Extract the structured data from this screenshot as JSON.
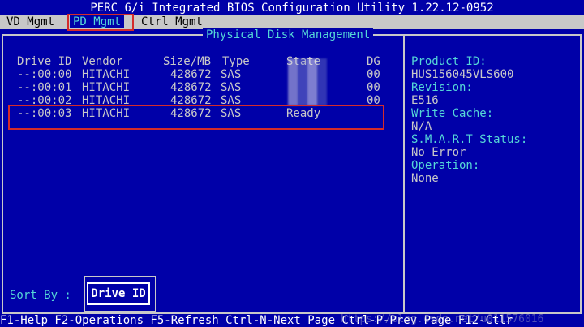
{
  "app": {
    "title": "PERC 6/i Integrated BIOS Configuration Utility 1.22.12-0952"
  },
  "menu": [
    {
      "label": "VD Mgmt"
    },
    {
      "label": "PD Mgmt"
    },
    {
      "label": "Ctrl Mgmt"
    }
  ],
  "panel": {
    "title": "Physical Disk Management"
  },
  "table": {
    "headers": {
      "drive_id": "Drive ID",
      "vendor": "Vendor",
      "size": "Size/MB",
      "type": "Type",
      "state": "State",
      "dg": "DG"
    },
    "rows": [
      {
        "drive_id": "--:00:00",
        "vendor": "HITACHI",
        "size": "428672",
        "type": "SAS",
        "state": "",
        "dg": "00"
      },
      {
        "drive_id": "--:00:01",
        "vendor": "HITACHI",
        "size": "428672",
        "type": "SAS",
        "state": "",
        "dg": "00"
      },
      {
        "drive_id": "--:00:02",
        "vendor": "HITACHI",
        "size": "428672",
        "type": "SAS",
        "state": "",
        "dg": "00"
      },
      {
        "drive_id": "--:00:03",
        "vendor": "HITACHI",
        "size": "428672",
        "type": "SAS",
        "state": "Ready",
        "dg": ""
      }
    ]
  },
  "details": {
    "product_id_label": "Product ID:",
    "product_id_value": "HUS156045VLS600",
    "revision_label": "Revision:",
    "revision_value": "E516",
    "write_cache_label": "Write Cache:",
    "write_cache_value": "N/A",
    "smart_label": "S.M.A.R.T Status:",
    "smart_value": "No Error",
    "operation_label": "Operation:",
    "operation_value": "None"
  },
  "sort": {
    "label": "Sort By :",
    "value": "Drive ID"
  },
  "footer": {
    "text": "F1-Help F2-Operations F5-Refresh Ctrl-N-Next Page Ctrl-P-Prev Page F12-Ctlr"
  },
  "watermark": {
    "text": "https://blog.csdn.net/u011576016"
  },
  "colors": {
    "background": "#0000a8",
    "accent": "#55d7d7",
    "text": "#c8c8c8",
    "highlight_box": "#d42b2b"
  }
}
